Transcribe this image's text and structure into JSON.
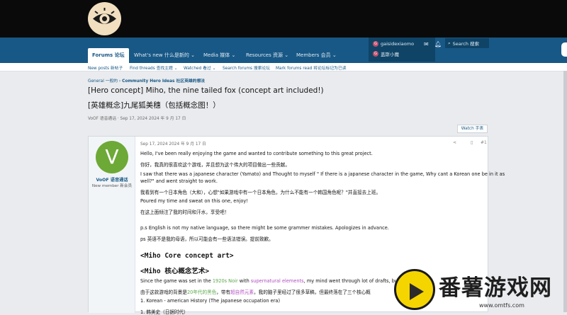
{
  "header": {
    "logo_icon": "eye-emblem-icon"
  },
  "nav": {
    "tabs": [
      "Forums 论坛",
      "What's new 什么是新的 ⌄",
      "Media 媒体 ⌄",
      "Resources 资源 ⌄",
      "Members 会员 ⌄"
    ]
  },
  "user": {
    "name": "gaisidexiaomo",
    "alias": "盖斯小魔",
    "avatar_letter": "G",
    "search": "Search 搜索"
  },
  "subnav": [
    "New posts 新帖子",
    "Find threads 查找主题 ⌄",
    "Watched 看过 ⌄",
    "Search forums 搜索论坛",
    "Mark forums read 将论坛标记为已读"
  ],
  "breadcrumb": {
    "first": "General 一般的",
    "second": "Community Hero Ideas 社区英雄的想法"
  },
  "thread": {
    "title_en": "[Hero concept] Miho, the nine tailed fox (concept art included!)",
    "title_zh": "[英雄概念]九尾狐美穗（包括概念图！）",
    "meta": "VoOF 语音通话 · Sep 17, 2024 2024 年 9 月 17 日",
    "watch": "Watch 手表"
  },
  "post": {
    "author": "VoOF 语音通话",
    "author_letter": "V",
    "author_title": "New member 新会员",
    "date": "Sep 17, 2024 2024 年 9 月 17 日",
    "number": "#1",
    "lines": [
      "Hello, I've been really enjoying the game and wanted to contribute something to this great project.",
      "你好，我真的很喜欢这个游戏，并且想为这个伟大的项目做出一些贡献。",
      "I saw that there was a japanese character (Yamato) and Thought to myself \" If there is a japanese character in the game, Why cant a Korean one be in it as",
      "well?\" and went straight to work.",
      "我看到有一个日本角色（大和），心想\"如果游戏中有一个日本角色，为什么不能有一个韩国角色呢？\"并直接去上班。",
      "Poured my time and sweat on this one, enjoy!",
      "在这上面倾注了我的时间和汗水，享受吧！",
      "p.s English is not my native language, so there might be some grammer mistakes. Apologizes in advance.",
      "ps 英语不是我的母语，所以可能会有一些语法错误。提前致歉。"
    ],
    "h1": "<Miho Core concept art>",
    "h2": "<Miho 核心概念艺术>",
    "since_a": "Since the game was set in the ",
    "since_b": "1920s Noir",
    "since_c": " with ",
    "since_d": "supernatural elements",
    "since_e": ", my mind went through lot of drafts, but u",
    "zh_a": "由于这款游戏的背景是",
    "zh_b": "20年代的黑色",
    "zh_c": "，带有",
    "zh_d": "超自然元素",
    "zh_e": "，我的脑子里经过了很多草稿，但最终落在了三个核心概",
    "list1": "1. Korean - american History (The japanese occupation era)",
    "list2": "1. 韩美史（日据时代）"
  },
  "watermark": {
    "text": "番薯游戏网",
    "url": "www.omtfs.com"
  }
}
